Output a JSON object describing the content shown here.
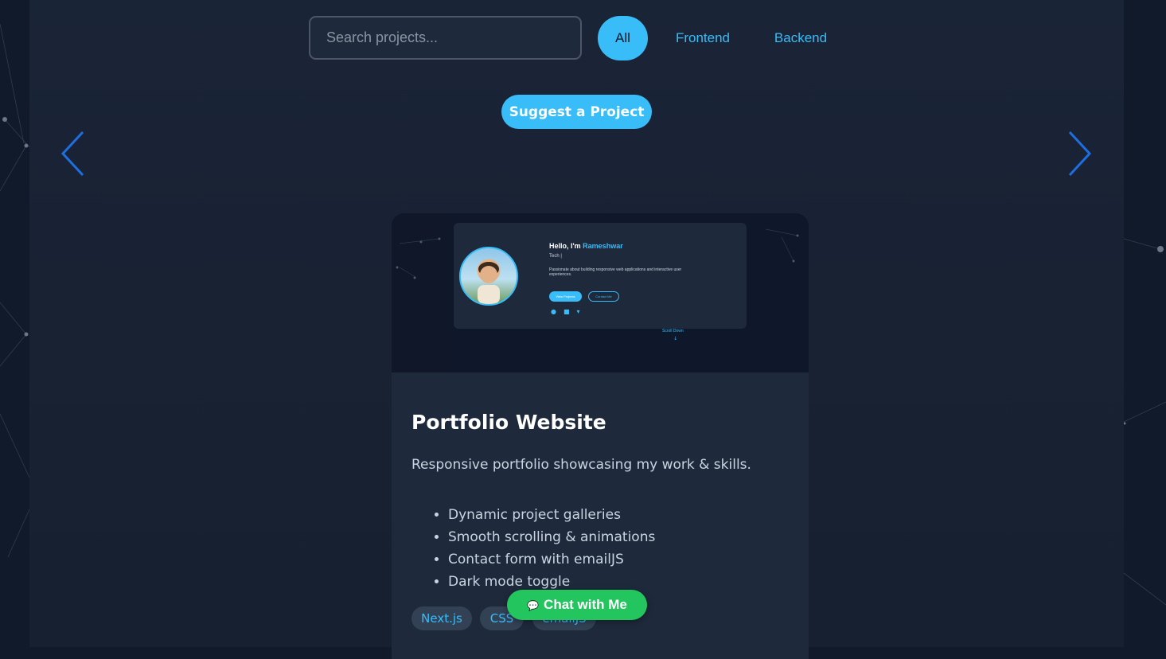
{
  "search": {
    "placeholder": "Search projects..."
  },
  "filters": [
    {
      "label": "All",
      "active": true
    },
    {
      "label": "Frontend",
      "active": false
    },
    {
      "label": "Backend",
      "active": false
    }
  ],
  "suggest_button": {
    "label": "Suggest a Project"
  },
  "carousel": {
    "prev_icon": "chevron-left-icon",
    "next_icon": "chevron-right-icon",
    "arrow_color": "#1d6fe0"
  },
  "project": {
    "preview": {
      "hello": "Hello, I'm",
      "name": "Rameshwar",
      "role": "Tech |",
      "description": "Passionate about building responsive web applications and interactive user experiences.",
      "btn_projects": "View Projects",
      "btn_contact": "Contact Me",
      "social_icons": [
        "github-icon",
        "linkedin-icon",
        "twitter-icon"
      ],
      "scroll": "Scroll Down"
    },
    "title": "Portfolio Website",
    "description": "Responsive portfolio showcasing my work & skills.",
    "features": [
      "Dynamic project galleries",
      "Smooth scrolling & animations",
      "Contact form with emailJS",
      "Dark mode toggle"
    ],
    "tags": [
      "Next.js",
      "CSS",
      "emailJS"
    ]
  },
  "chat_button": {
    "label": "Chat with Me",
    "icon": "speech-bubble-icon"
  },
  "colors": {
    "accent": "#38bdf8",
    "chat": "#22c55e",
    "card": "#1e293b",
    "background": "#111a2b"
  }
}
